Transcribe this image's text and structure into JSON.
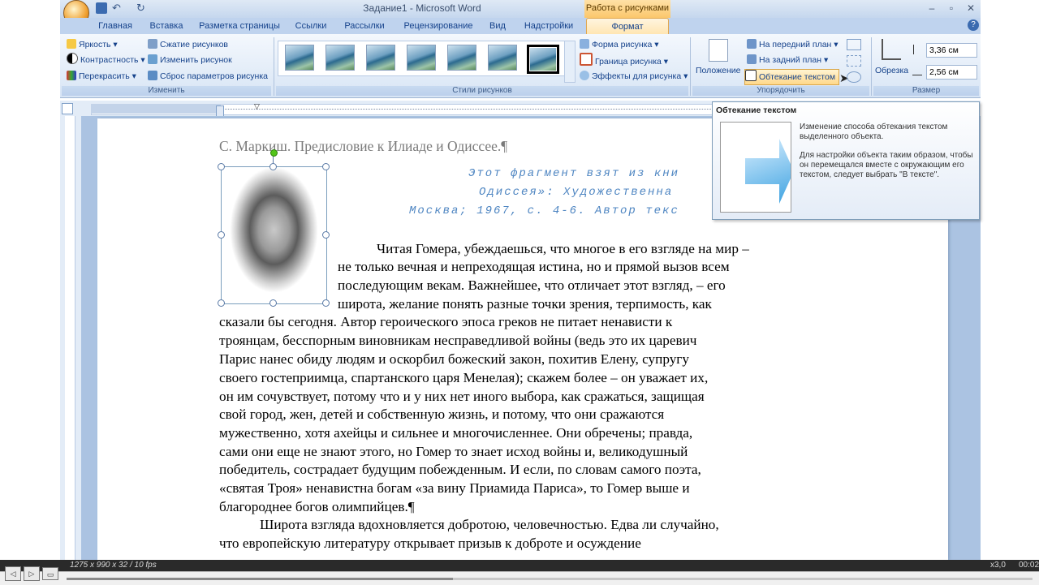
{
  "window": {
    "title": "Задание1 - Microsoft Word",
    "context_tab_title": "Работа с рисунками"
  },
  "tabs": [
    "Главная",
    "Вставка",
    "Разметка страницы",
    "Ссылки",
    "Рассылки",
    "Рецензирование",
    "Вид",
    "Надстройки",
    "Формат"
  ],
  "active_tab": "Формат",
  "ribbon": {
    "adjust": {
      "items": [
        "Яркость",
        "Контрастность",
        "Перекрасить",
        "Сжатие рисунков",
        "Изменить рисунок",
        "Сброс параметров рисунка"
      ],
      "label": "Изменить"
    },
    "styles": {
      "label": "Стили рисунков",
      "buttons": [
        "Форма рисунка",
        "Граница рисунка",
        "Эффекты для рисунка"
      ]
    },
    "arrange": {
      "position_label": "Положение",
      "items": [
        "На передний план",
        "На задний план",
        "Обтекание текстом"
      ],
      "label": "Упорядочить"
    },
    "size": {
      "crop_label": "Обрезка",
      "height": "3,36 см",
      "width": "2,56 см",
      "label": "Размер"
    }
  },
  "tooltip": {
    "title": "Обтекание текстом",
    "text1": "Изменение способа обтекания текстом выделенного объекта.",
    "text2": "Для настройки объекта таким образом, чтобы он перемещался вместе с окружающим его текстом, следует выбрать \"В тексте\"."
  },
  "document": {
    "heading": "С. Маркиш. Предисловие к Илиаде и Одиссее.¶",
    "epigraph": [
      "Этот фрагмент взят из кни",
      "Одиссея»: Художественна",
      "Москва; 1967, с. 4-6. Автор текс"
    ],
    "lines": [
      "Читая Гомера, убеждаешься, что многое в его взгляде на мир –",
      "не только вечная и непреходящая истина, но и прямой вызов всем",
      "последующим векам. Важнейшее, что отличает этот взгляд, – его",
      "широта, желание понять разные точки зрения, терпимость, как",
      "сказали бы сегодня. Автор героического эпоса греков не питает ненависти к",
      "троянцам, бесспорным виновникам несправедливой войны (ведь это их царевич",
      "Парис нанес обиду людям и оскорбил божеский закон, похитив Елену, супругу",
      "своего гостеприимца, спартанского царя Менелая); скажем более – он уважает их,",
      "он им сочувствует, потому что и у них нет иного выбора, как сражаться, защищая",
      "свой город, жен, детей и собственную жизнь, и потому, что они сражаются",
      "мужественно, хотя ахейцы и сильнее и многочисленнее. Они обречены; правда,",
      "сами они еще не знают этого, но Гомер то знает исход войны и, великодушный",
      "победитель, сострадает будущим побежденным. И если, по словам самого поэта,",
      "«святая Троя» ненавистна богам «за вину Приамида Париса», то Гомер выше и",
      "благороднее богов олимпийцев.¶",
      "Широта взгляда вдохновляется добротою, человечностью. Едва ли случайно,",
      "что европейскую литературу открывает призыв к доброте и осуждение"
    ]
  },
  "player": {
    "info": "1275 x 990 x 32 / 10 fps",
    "zoom": "x3,0",
    "time": "00:02",
    "progress": 0.4
  },
  "colors": {
    "ribbon_bg": "#d8e5f5",
    "context_tab": "#fbc76c",
    "epigraph": "#4f86c2"
  }
}
